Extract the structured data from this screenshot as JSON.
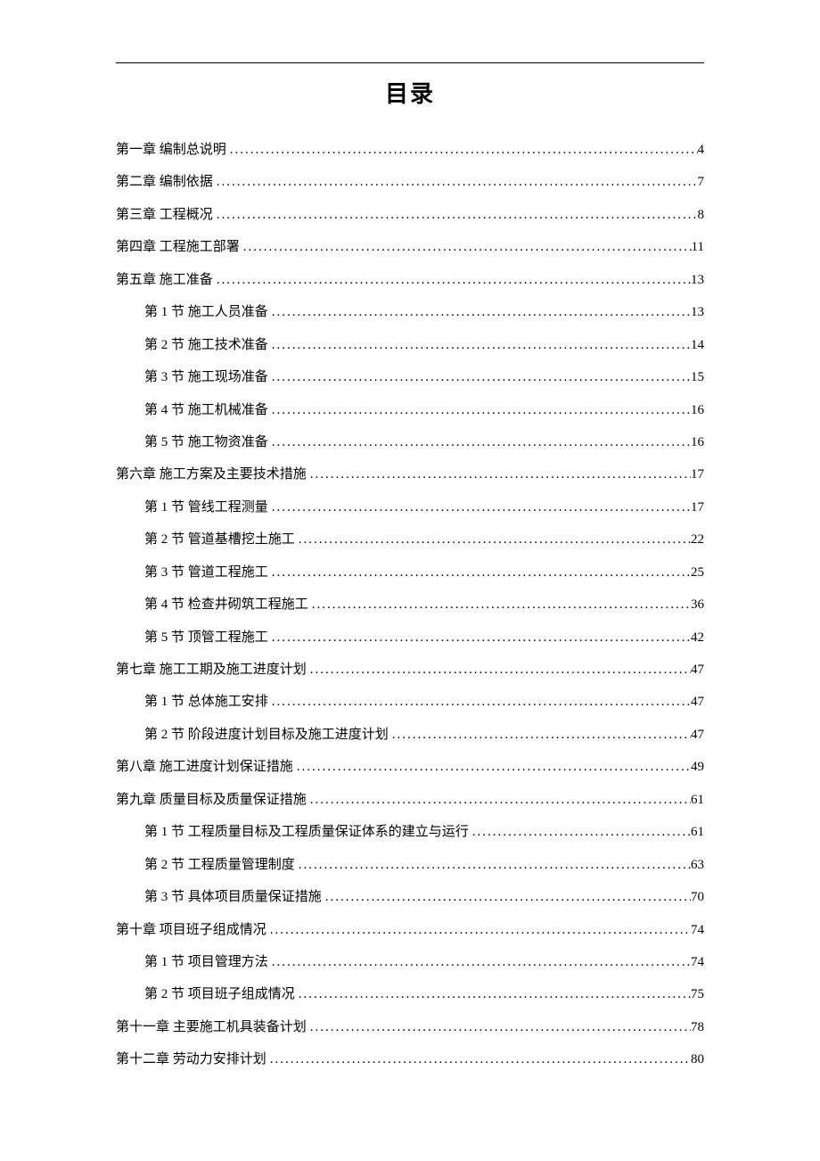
{
  "title": "目录",
  "toc": [
    {
      "level": 1,
      "label": "第一章 编制总说明",
      "page": "4"
    },
    {
      "level": 1,
      "label": "第二章 编制依据",
      "page": "7"
    },
    {
      "level": 1,
      "label": "第三章 工程概况",
      "page": "8"
    },
    {
      "level": 1,
      "label": "第四章 工程施工部署",
      "page": "11"
    },
    {
      "level": 1,
      "label": "第五章 施工准备",
      "page": "13"
    },
    {
      "level": 2,
      "label": "第 1 节 施工人员准备",
      "page": "13"
    },
    {
      "level": 2,
      "label": "第 2 节 施工技术准备",
      "page": "14"
    },
    {
      "level": 2,
      "label": "第 3 节 施工现场准备",
      "page": "15"
    },
    {
      "level": 2,
      "label": "第 4 节 施工机械准备",
      "page": "16"
    },
    {
      "level": 2,
      "label": "第 5 节 施工物资准备",
      "page": "16"
    },
    {
      "level": 1,
      "label": "第六章 施工方案及主要技术措施",
      "page": "17"
    },
    {
      "level": 2,
      "label": "第 1 节 管线工程测量",
      "page": "17"
    },
    {
      "level": 2,
      "label": "第 2 节 管道基槽挖土施工",
      "page": "22"
    },
    {
      "level": 2,
      "label": "第 3 节 管道工程施工",
      "page": "25"
    },
    {
      "level": 2,
      "label": "第 4 节 检查井砌筑工程施工",
      "page": "36"
    },
    {
      "level": 2,
      "label": "第 5 节 顶管工程施工",
      "page": "42"
    },
    {
      "level": 1,
      "label": "第七章 施工工期及施工进度计划",
      "page": "47"
    },
    {
      "level": 2,
      "label": "第 1 节 总体施工安排",
      "page": "47"
    },
    {
      "level": 2,
      "label": "第 2 节 阶段进度计划目标及施工进度计划",
      "page": "47"
    },
    {
      "level": 1,
      "label": "第八章 施工进度计划保证措施",
      "page": "49"
    },
    {
      "level": 1,
      "label": "第九章 质量目标及质量保证措施",
      "page": "61"
    },
    {
      "level": 2,
      "label": "第 1 节 工程质量目标及工程质量保证体系的建立与运行",
      "page": "61"
    },
    {
      "level": 2,
      "label": "第 2 节 工程质量管理制度",
      "page": "63"
    },
    {
      "level": 2,
      "label": "第 3 节 具体项目质量保证措施",
      "page": "70"
    },
    {
      "level": 1,
      "label": "第十章 项目班子组成情况",
      "page": "74"
    },
    {
      "level": 2,
      "label": "第 1 节 项目管理方法",
      "page": "74"
    },
    {
      "level": 2,
      "label": "第 2 节 项目班子组成情况",
      "page": "75"
    },
    {
      "level": 1,
      "label": "第十一章 主要施工机具装备计划",
      "page": "78"
    },
    {
      "level": 1,
      "label": "第十二章 劳动力安排计划",
      "page": "80"
    }
  ]
}
